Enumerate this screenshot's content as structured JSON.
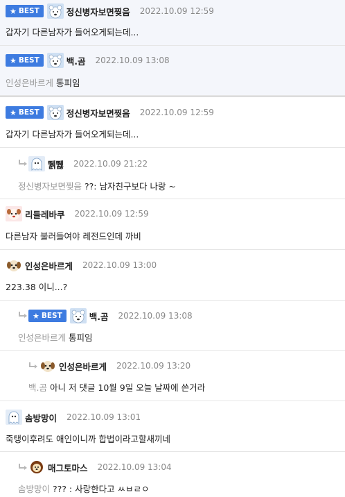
{
  "best_label": "BEST",
  "comments": [
    {
      "nick": "정신병자보면찢음",
      "date": "2022.10.09 12:59",
      "text": "갑자기 다른남자가 들어오게되는데..."
    },
    {
      "nick": "백.곰",
      "date": "2022.10.09 13:08",
      "mention": "인성은바르게",
      "text": "통피임"
    },
    {
      "nick": "정신병자보면찢음",
      "date": "2022.10.09 12:59",
      "text": "갑자기 다른남자가 들어오게되는데..."
    },
    {
      "nick": "뛝뛣",
      "date": "2022.10.09 21:22",
      "mention": "정신병자보면찢음",
      "text": "??: 남자친구보다 나랑 ~"
    },
    {
      "nick": "리들레바쿠",
      "date": "2022.10.09 12:59",
      "text": "다른남자 불러들여야 레전드인데 까비"
    },
    {
      "nick": "인성은바르게",
      "date": "2022.10.09 13:00",
      "text": "223.38 이니...?"
    },
    {
      "nick": "백.곰",
      "date": "2022.10.09 13:08",
      "mention": "인성은바르게",
      "text": "통피임"
    },
    {
      "nick": "인성은바르게",
      "date": "2022.10.09 13:20",
      "mention": "백.곰",
      "text": "아니 저 댓글 10월 9일 오늘 날짜에 쓴거라"
    },
    {
      "nick": "솜방망이",
      "date": "2022.10.09 13:01",
      "text": "죽탱이후려도 애인이니까 합법이라고할새끼네"
    },
    {
      "nick": "매그토마스",
      "date": "2022.10.09 13:04",
      "mention": "솜방망이",
      "text": "??? : 사랑한다고 ㅆㅂㄹㅇ"
    }
  ],
  "colors": {
    "accent": "#3d7be0",
    "best_bg": "#f4f6fb",
    "muted": "#888888"
  }
}
